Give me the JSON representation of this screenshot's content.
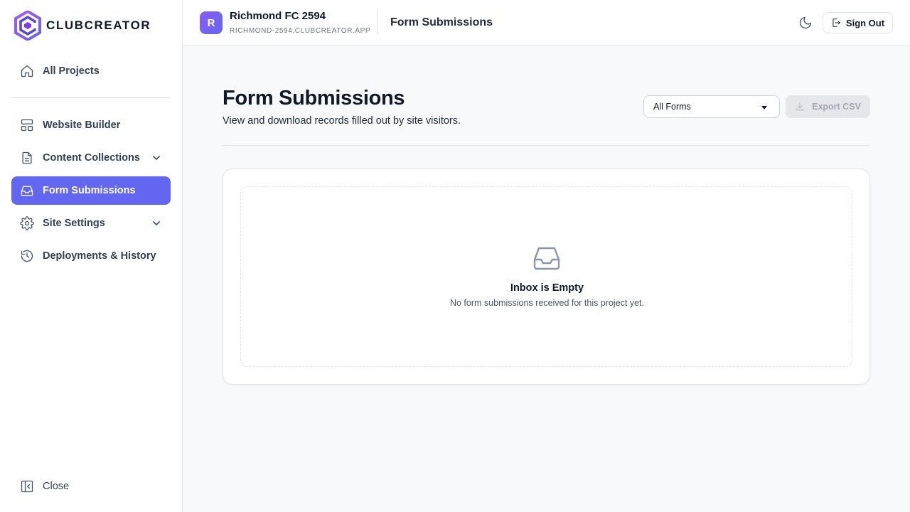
{
  "app": {
    "logo_text": "CLUBCREATOR"
  },
  "sidebar": {
    "all_projects": "All Projects",
    "items": [
      {
        "label": "Website Builder",
        "icon": "layout-icon"
      },
      {
        "label": "Content Collections",
        "icon": "document-icon",
        "expandable": true
      },
      {
        "label": "Form Submissions",
        "icon": "inbox-icon",
        "active": true
      },
      {
        "label": "Site Settings",
        "icon": "gear-icon",
        "expandable": true
      },
      {
        "label": "Deployments & History",
        "icon": "history-icon"
      }
    ],
    "close_label": "Close"
  },
  "header": {
    "avatar_letter": "R",
    "project_name": "Richmond FC 2594",
    "project_domain": "RICHMOND-2594.CLUBCREATOR.APP",
    "section_title": "Form Submissions",
    "sign_out_label": "Sign Out"
  },
  "main": {
    "title": "Form Submissions",
    "subtitle": "View and download records filled out by site visitors.",
    "form_filter": {
      "selected": "All Forms"
    },
    "export_label": "Export CSV",
    "empty_state": {
      "title": "Inbox is Empty",
      "message": "No form submissions received for this project yet."
    }
  },
  "colors": {
    "accent": "#6366f1",
    "avatar_gradient_start": "#8b5cf6",
    "background": "#f8f9fb"
  }
}
